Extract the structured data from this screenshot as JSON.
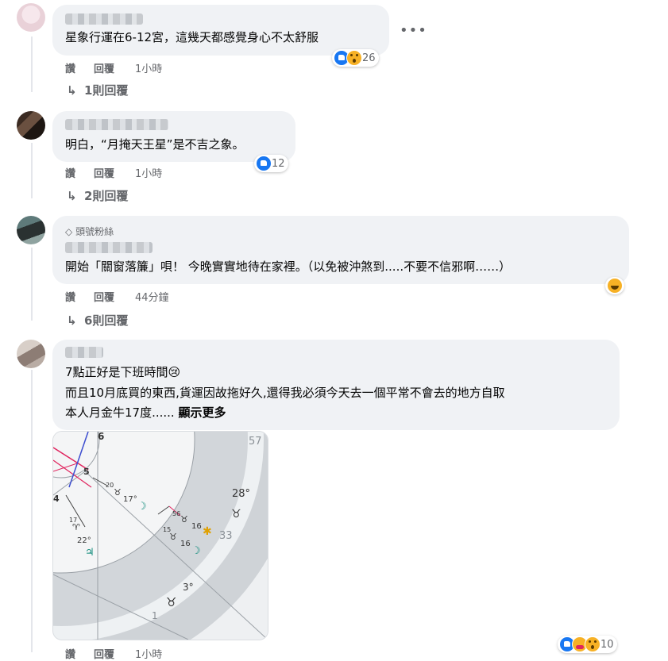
{
  "comments": [
    {
      "text": "星象行運在6-12宮，這幾天都感覺身心不太舒服",
      "actions": {
        "like": "讚",
        "reply": "回覆",
        "time": "1小時"
      },
      "reactions": {
        "count": "26",
        "types": [
          "like-icon",
          "wow-icon"
        ]
      },
      "replies_label": "1則回覆"
    },
    {
      "text": "明白，“月掩天王星”是不吉之象。",
      "actions": {
        "like": "讚",
        "reply": "回覆",
        "time": "1小時"
      },
      "reactions": {
        "count": "12",
        "types": [
          "like-icon"
        ]
      },
      "replies_label": "2則回覆"
    },
    {
      "badge": "頭號粉絲",
      "text": "開始「關窗落簾」唄！ 今晚實實地待在家裡。（以免被沖煞到.....不要不信邪啊……）",
      "actions": {
        "like": "讚",
        "reply": "回覆",
        "time": "44分鐘"
      },
      "reactions": {
        "types": [
          "laugh-icon"
        ]
      },
      "replies_label": "6則回覆"
    },
    {
      "lines": [
        "7點正好是下班時間😢",
        "而且10月底買的東西,貨運因故拖好久,還得我必須今天去一個平常不會去的地方自取",
        "本人月金牛17度......"
      ],
      "see_more": "顯示更多",
      "actions": {
        "like": "讚",
        "reply": "回覆",
        "time": "1小時"
      },
      "reactions": {
        "count": "10",
        "types": [
          "like-icon",
          "care-icon",
          "wow-icon"
        ]
      }
    }
  ],
  "more_options": "•••",
  "chart_labels": {
    "house_6": "6",
    "house_5": "5",
    "house_4": "4",
    "house_1": "1",
    "deg_57": "57",
    "deg_28": "28°",
    "deg_33": "33",
    "deg_3": "3°",
    "deg_20": "20",
    "deg_17a": "17°",
    "deg_17b": "17",
    "deg_22": "22°",
    "deg_56": "56",
    "deg_15": "15",
    "deg_16a": "16",
    "deg_16b": "16"
  },
  "colors": {
    "bubble": "#f0f2f5",
    "meta": "#65676b",
    "like": "#1877f2",
    "emoji": "#f7b125"
  }
}
